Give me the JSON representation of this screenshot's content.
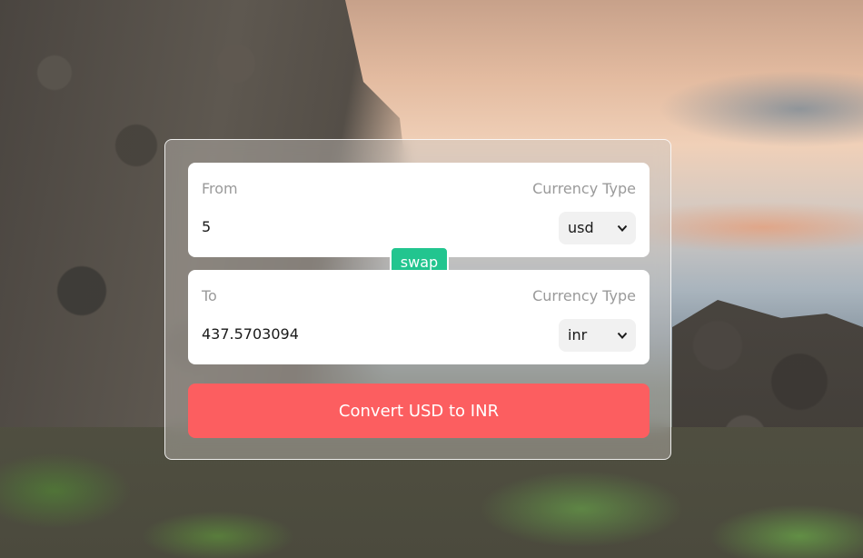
{
  "from": {
    "label": "From",
    "currency_type_label": "Currency Type",
    "amount": "5",
    "currency": "usd"
  },
  "to": {
    "label": "To",
    "currency_type_label": "Currency Type",
    "amount": "437.5703094",
    "currency": "inr"
  },
  "swap_label": "swap",
  "convert_label": "Convert USD to INR",
  "icons": {
    "select_chevron": "chevron-down-icon"
  },
  "colors": {
    "swap": "#22c58f",
    "convert": "#fc5e60"
  }
}
